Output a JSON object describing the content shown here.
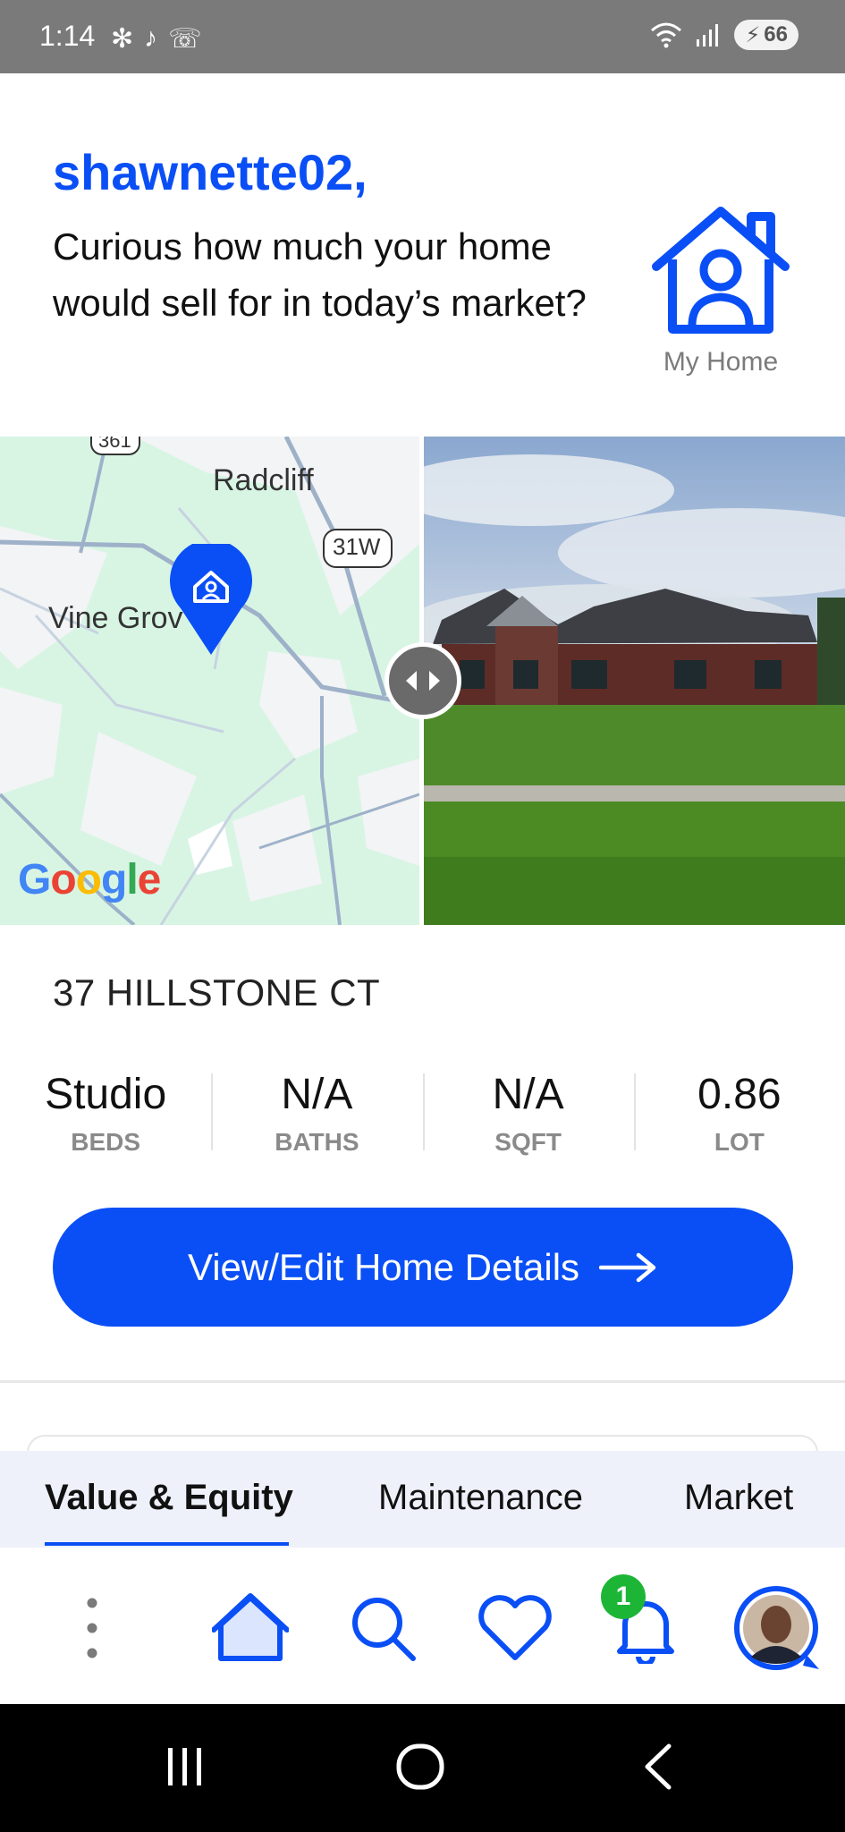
{
  "status_bar": {
    "time": "1:14",
    "battery": "66",
    "network": "6"
  },
  "header": {
    "username": "shawnette02,",
    "prompt": "Curious how much your home would sell for in today’s market?",
    "my_home_label": "My Home"
  },
  "map": {
    "labels": {
      "radcliff": "Radcliff",
      "vine_grove": "Vine Grov",
      "route_31w": "31W",
      "route_361": "361",
      "google": "Google"
    }
  },
  "property": {
    "address": "37 HILLSTONE CT",
    "stats": [
      {
        "value": "Studio",
        "label": "BEDS"
      },
      {
        "value": "N/A",
        "label": "BATHS"
      },
      {
        "value": "N/A",
        "label": "SQFT"
      },
      {
        "value": "0.86",
        "label": "LOT"
      }
    ],
    "cta_label": "View/Edit Home Details"
  },
  "tabs": [
    {
      "label": "Value & Equity",
      "active": true
    },
    {
      "label": "Maintenance",
      "active": false
    },
    {
      "label": "Market",
      "active": false
    }
  ],
  "bottom_nav": {
    "items": [
      "more-icon",
      "home-icon",
      "search-icon",
      "heart-icon",
      "bell-icon",
      "avatar"
    ],
    "notification_count": "1"
  },
  "colors": {
    "brand_blue": "#0a4ff5",
    "badge_green": "#1db536"
  }
}
